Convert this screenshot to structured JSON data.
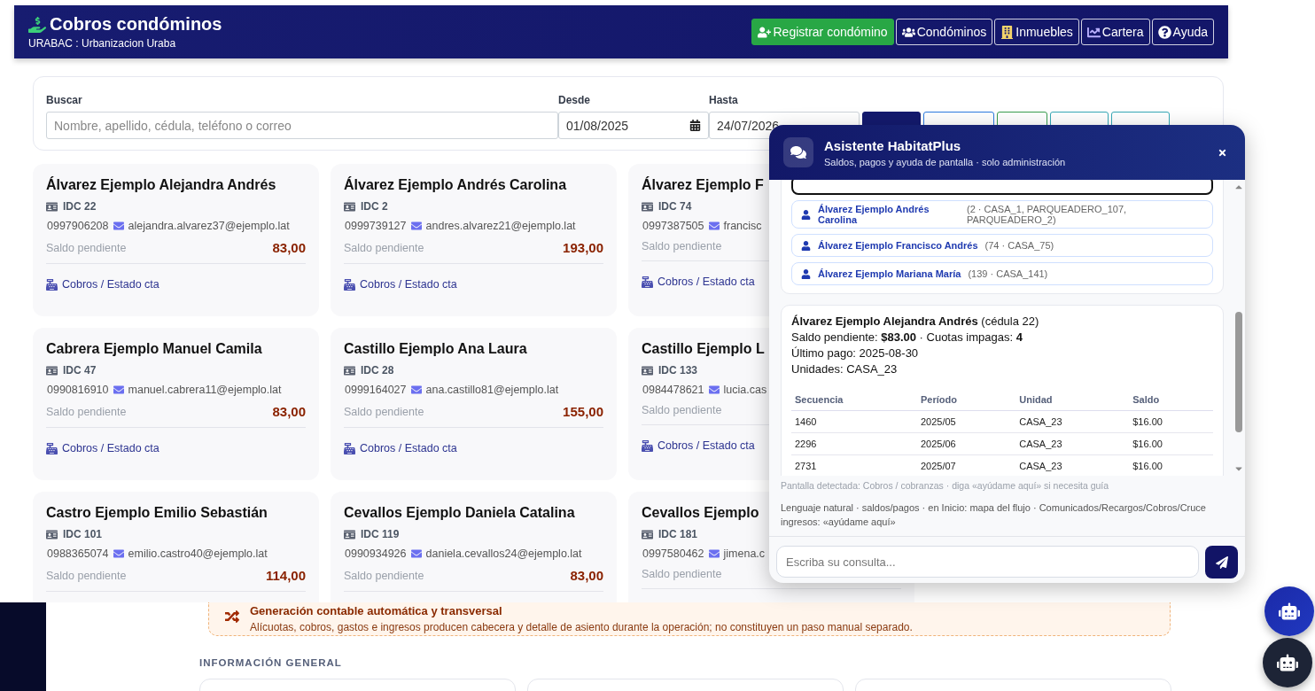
{
  "header": {
    "title": "Cobros condóminos",
    "subtitle": "URABAC : Urbanizacion Uraba",
    "actions": [
      {
        "label": "Registrar condómino",
        "kind": "primary"
      },
      {
        "label": "Condóminos",
        "kind": "outline"
      },
      {
        "label": "Inmuebles",
        "kind": "outline"
      },
      {
        "label": "Cartera",
        "kind": "outline"
      },
      {
        "label": "Ayuda",
        "kind": "outline"
      }
    ]
  },
  "filters": {
    "search": {
      "label": "Buscar",
      "placeholder": "Nombre, apellido, cédula, teléfono o correo"
    },
    "from": {
      "label": "Desde",
      "value": "01/08/2025"
    },
    "to": {
      "label": "Hasta",
      "value": "24/07/2026"
    },
    "buttons": [
      {
        "kind": "dark"
      },
      {
        "kind": "blue"
      },
      {
        "kind": "green"
      },
      {
        "kind": "teal"
      },
      {
        "kind": "teal"
      }
    ]
  },
  "cards": [
    {
      "name": "Álvarez Ejemplo Alejandra Andrés",
      "id": "IDC 22",
      "phone": "0997906208",
      "email": "alejandra.alvarez37@ejemplo.lat",
      "balance_label": "Saldo pendiente",
      "balance": "83,00",
      "link": "Cobros / Estado cta"
    },
    {
      "name": "Álvarez Ejemplo Andrés Carolina",
      "id": "IDC 2",
      "phone": "0999739127",
      "email": "andres.alvarez21@ejemplo.lat",
      "balance_label": "Saldo pendiente",
      "balance": "193,00",
      "link": "Cobros / Estado cta"
    },
    {
      "name": "Álvarez Ejemplo F",
      "id": "IDC 74",
      "phone": "0997387505",
      "email": "francisc",
      "balance_label": "Saldo pendiente",
      "link": "Cobros / Estado cta"
    },
    {
      "name": "Cabrera Ejemplo Manuel Camila",
      "id": "IDC 47",
      "phone": "0990816910",
      "email": "manuel.cabrera11@ejemplo.lat",
      "balance_label": "Saldo pendiente",
      "balance": "83,00",
      "link": "Cobros / Estado cta"
    },
    {
      "name": "Castillo Ejemplo Ana Laura",
      "id": "IDC 28",
      "phone": "0999164027",
      "email": "ana.castillo81@ejemplo.lat",
      "balance_label": "Saldo pendiente",
      "balance": "155,00",
      "link": "Cobros / Estado cta"
    },
    {
      "name": "Castillo Ejemplo L",
      "id": "IDC 133",
      "phone": "0984478621",
      "email": "lucia.cas",
      "balance_label": "Saldo pendiente",
      "link": "Cobros / Estado cta"
    },
    {
      "name": "Castro Ejemplo Emilio Sebastián",
      "id": "IDC 101",
      "phone": "0988365074",
      "email": "emilio.castro40@ejemplo.lat",
      "balance_label": "Saldo pendiente",
      "balance": "114,00"
    },
    {
      "name": "Cevallos Ejemplo Daniela Catalina",
      "id": "IDC 119",
      "phone": "0990934926",
      "email": "daniela.cevallos24@ejemplo.lat",
      "balance_label": "Saldo pendiente",
      "balance": "83,00"
    },
    {
      "name": "Cevallos Ejemplo",
      "id": "IDC 181",
      "phone": "0997580462",
      "email": "jimena.c",
      "balance_label": "Saldo pendiente"
    }
  ],
  "chat": {
    "title": "Asistente HabitatPlus",
    "subtitle": "Saldos, pagos y ayuda de pantalla · solo administración",
    "results": [
      {
        "selected": true
      },
      {
        "name": "Álvarez Ejemplo Andrés Carolina",
        "detail": "(2 · CASA_1, PARQUEADERO_107, PARQUEADERO_2)",
        "selected": false
      },
      {
        "name": "Álvarez Ejemplo Francisco Andrés",
        "detail": "(74 · CASA_75)",
        "selected": false
      },
      {
        "name": "Álvarez Ejemplo Mariana María",
        "detail": "(139 · CASA_141)",
        "selected": false
      }
    ],
    "answer": {
      "lines": [
        "**Álvarez Ejemplo Alejandra Andrés** (cédula 22)",
        "Saldo pendiente: **$83.00** · Cuotas impagas: **4**",
        "Último pago: 2025-08-30",
        "Unidades: CASA_23"
      ],
      "table": {
        "columns": [
          "Secuencia",
          "Período",
          "Unidad",
          "Saldo"
        ],
        "rows": [
          [
            "1460",
            "2025/05",
            "CASA_23",
            "$16.00"
          ],
          [
            "2296",
            "2025/06",
            "CASA_23",
            "$16.00"
          ],
          [
            "2731",
            "2025/07",
            "CASA_23",
            "$16.00"
          ]
        ]
      }
    },
    "hints": [
      "Pantalla detectada: Cobros / cobranzas · diga «ayúdame aquí» si necesita guía",
      "Lenguaje natural · saldos/pagos · en Inicio: mapa del flujo · Comunicados/Recargos/Cobros/Cruce ingresos: «ayúdame aquí»"
    ],
    "input": {
      "placeholder": "Escriba su consulta..."
    }
  },
  "background_page": {
    "banner": {
      "title": "Generación contable automática y transversal",
      "text": "Alícuotas, cobros, gastos e ingresos producen cabecera y detalle de asiento durante la operación; no constituyen un paso manual separado."
    },
    "section_title": "INFORMACIÓN GENERAL"
  }
}
